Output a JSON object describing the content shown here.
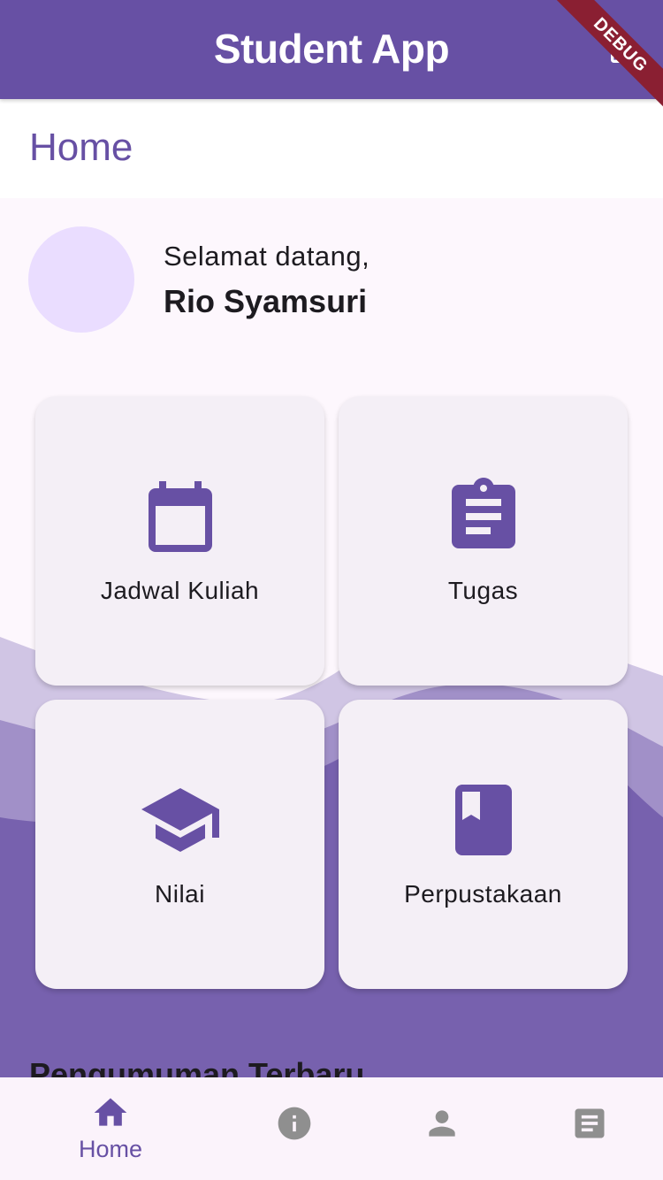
{
  "app_bar": {
    "title": "Student App",
    "action_icon": "logout-icon",
    "debug_banner": "DEBUG"
  },
  "page": {
    "title": "Home"
  },
  "greeting": {
    "welcome": "Selamat datang,",
    "name": "Rio Syamsuri"
  },
  "menu": [
    {
      "label": "Jadwal Kuliah",
      "icon": "calendar-icon"
    },
    {
      "label": "Tugas",
      "icon": "clipboard-icon"
    },
    {
      "label": "Nilai",
      "icon": "graduation-cap-icon"
    },
    {
      "label": "Perpustakaan",
      "icon": "book-icon"
    }
  ],
  "announcements": {
    "title": "Pengumuman Terbaru"
  },
  "bottom_nav": [
    {
      "label": "Home",
      "icon": "home-icon",
      "active": true
    },
    {
      "label": "",
      "icon": "info-icon",
      "active": false
    },
    {
      "label": "",
      "icon": "person-icon",
      "active": false
    },
    {
      "label": "",
      "icon": "article-icon",
      "active": false
    }
  ],
  "colors": {
    "primary": "#6750a4",
    "surface": "#fdf7fd",
    "card": "#f4eff6",
    "avatar": "#eaddff",
    "inactive_icon": "#8f8f8f"
  }
}
